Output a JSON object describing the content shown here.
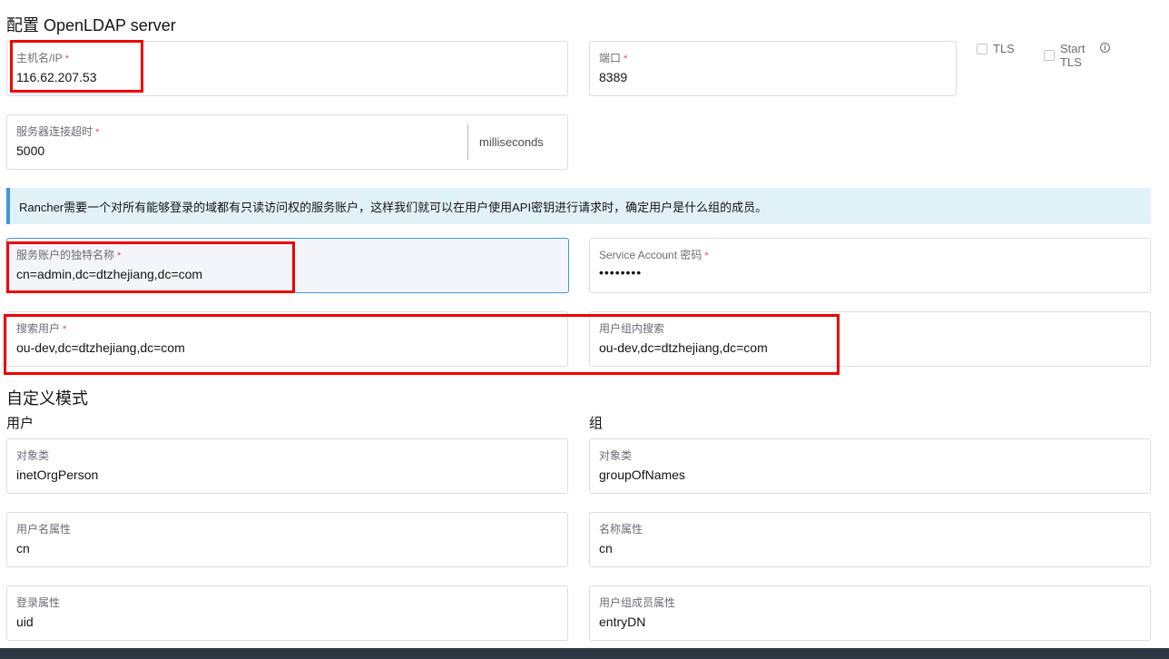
{
  "page": {
    "title": "配置 OpenLDAP server"
  },
  "server": {
    "host": {
      "label": "主机名/IP",
      "required": "*",
      "value": "116.62.207.53"
    },
    "port": {
      "label": "端口",
      "required": "*",
      "value": "8389"
    },
    "tls_label": "TLS",
    "start_tls_label_line1": "Start",
    "start_tls_label_line2": "TLS",
    "info_glyph": "i",
    "timeout": {
      "label": "服务器连接超时",
      "required": "*",
      "value": "5000",
      "suffix": "milliseconds"
    }
  },
  "banner": {
    "text": "Rancher需要一个对所有能够登录的域都有只读访问权的服务账户，这样我们就可以在用户使用API密钥进行请求时，确定用户是什么组的成员。"
  },
  "account": {
    "dn": {
      "label": "服务账户的独特名称",
      "required": "*",
      "value": "cn=admin,dc=dtzhejiang,dc=com"
    },
    "password": {
      "label": "Service Account 密码",
      "required": "*",
      "value": "••••••••"
    }
  },
  "search": {
    "user": {
      "label": "搜索用户",
      "required": "*",
      "value": "ou-dev,dc=dtzhejiang,dc=com"
    },
    "group": {
      "label": "用户组内搜索",
      "value": "ou-dev,dc=dtzhejiang,dc=com"
    }
  },
  "schema": {
    "title": "自定义模式",
    "user_heading": "用户",
    "group_heading": "组",
    "user_object_class": {
      "label": "对象类",
      "value": "inetOrgPerson"
    },
    "user_name_attr": {
      "label": "用户名属性",
      "value": "cn"
    },
    "user_login_attr": {
      "label": "登录属性",
      "value": "uid"
    },
    "group_object_class": {
      "label": "对象类",
      "value": "groupOfNames"
    },
    "group_name_attr": {
      "label": "名称属性",
      "value": "cn"
    },
    "group_member_attr": {
      "label": "用户组成员属性",
      "value": "entryDN"
    }
  },
  "colors": {
    "required": "#f64747",
    "accent": "#3d98d3",
    "banner_bg": "#e1f1f8",
    "highlight": "#ee0000"
  }
}
